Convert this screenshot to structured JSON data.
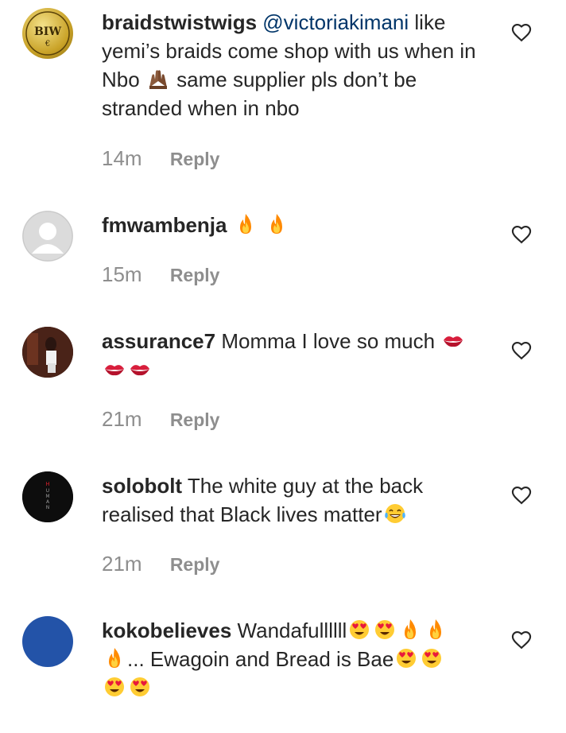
{
  "comments": [
    {
      "username": "braidstwistwigs",
      "mention": "@victoriakimani",
      "text_1": " like yemi’s braids come shop with us when in Nbo ",
      "emoji_1": "raised-hands",
      "text_2": " same supplier pls don’t be stranded when in nbo",
      "time": "14m",
      "reply": "Reply",
      "avatar_text": "BIW",
      "avatar_subtext": "€"
    },
    {
      "username": "fmwambenja",
      "emojis": [
        "fire",
        "fire"
      ],
      "time": "15m",
      "reply": "Reply"
    },
    {
      "username": "assurance7",
      "text": " Momma I love so much ",
      "emojis": [
        "kiss-mark",
        "kiss-mark",
        "kiss-mark"
      ],
      "time": "21m",
      "reply": "Reply"
    },
    {
      "username": "solobolt",
      "text": " The white guy at the back realised that Black lives matter",
      "emojis": [
        "tears-of-joy"
      ],
      "time": "21m",
      "reply": "Reply",
      "avatar_text": "HUMAN"
    },
    {
      "username": "kokobelieves",
      "text_1": " Wandafullllll",
      "text_2": "... Ewagoin and Bread is Bae",
      "time": "",
      "reply": ""
    }
  ],
  "colors": {
    "text": "#262626",
    "mention": "#003569",
    "meta": "#8e8e8e",
    "avatar_blue": "#2353a8",
    "avatar_gray": "#d8d8d8"
  },
  "icons": {
    "like": "heart-outline-icon"
  }
}
